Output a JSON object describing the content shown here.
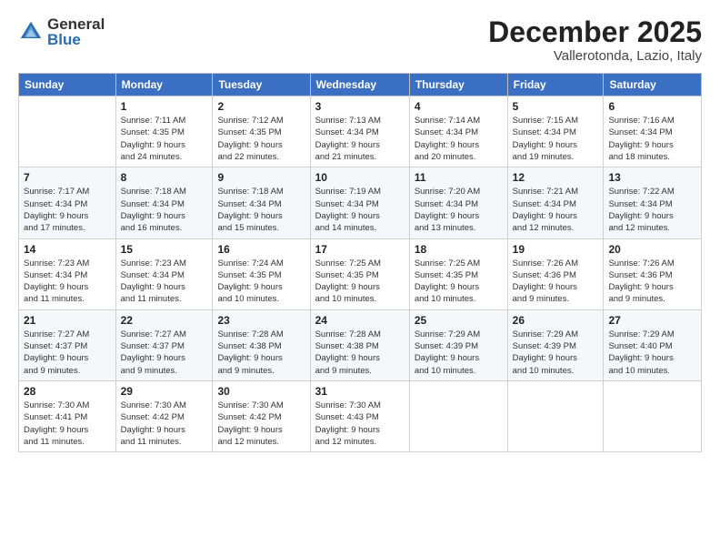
{
  "logo": {
    "general": "General",
    "blue": "Blue"
  },
  "header": {
    "month": "December 2025",
    "location": "Vallerotonda, Lazio, Italy"
  },
  "days_of_week": [
    "Sunday",
    "Monday",
    "Tuesday",
    "Wednesday",
    "Thursday",
    "Friday",
    "Saturday"
  ],
  "weeks": [
    [
      {
        "day": "",
        "content": ""
      },
      {
        "day": "1",
        "content": "Sunrise: 7:11 AM\nSunset: 4:35 PM\nDaylight: 9 hours\nand 24 minutes."
      },
      {
        "day": "2",
        "content": "Sunrise: 7:12 AM\nSunset: 4:35 PM\nDaylight: 9 hours\nand 22 minutes."
      },
      {
        "day": "3",
        "content": "Sunrise: 7:13 AM\nSunset: 4:34 PM\nDaylight: 9 hours\nand 21 minutes."
      },
      {
        "day": "4",
        "content": "Sunrise: 7:14 AM\nSunset: 4:34 PM\nDaylight: 9 hours\nand 20 minutes."
      },
      {
        "day": "5",
        "content": "Sunrise: 7:15 AM\nSunset: 4:34 PM\nDaylight: 9 hours\nand 19 minutes."
      },
      {
        "day": "6",
        "content": "Sunrise: 7:16 AM\nSunset: 4:34 PM\nDaylight: 9 hours\nand 18 minutes."
      }
    ],
    [
      {
        "day": "7",
        "content": "Sunrise: 7:17 AM\nSunset: 4:34 PM\nDaylight: 9 hours\nand 17 minutes."
      },
      {
        "day": "8",
        "content": "Sunrise: 7:18 AM\nSunset: 4:34 PM\nDaylight: 9 hours\nand 16 minutes."
      },
      {
        "day": "9",
        "content": "Sunrise: 7:18 AM\nSunset: 4:34 PM\nDaylight: 9 hours\nand 15 minutes."
      },
      {
        "day": "10",
        "content": "Sunrise: 7:19 AM\nSunset: 4:34 PM\nDaylight: 9 hours\nand 14 minutes."
      },
      {
        "day": "11",
        "content": "Sunrise: 7:20 AM\nSunset: 4:34 PM\nDaylight: 9 hours\nand 13 minutes."
      },
      {
        "day": "12",
        "content": "Sunrise: 7:21 AM\nSunset: 4:34 PM\nDaylight: 9 hours\nand 12 minutes."
      },
      {
        "day": "13",
        "content": "Sunrise: 7:22 AM\nSunset: 4:34 PM\nDaylight: 9 hours\nand 12 minutes."
      }
    ],
    [
      {
        "day": "14",
        "content": "Sunrise: 7:23 AM\nSunset: 4:34 PM\nDaylight: 9 hours\nand 11 minutes."
      },
      {
        "day": "15",
        "content": "Sunrise: 7:23 AM\nSunset: 4:34 PM\nDaylight: 9 hours\nand 11 minutes."
      },
      {
        "day": "16",
        "content": "Sunrise: 7:24 AM\nSunset: 4:35 PM\nDaylight: 9 hours\nand 10 minutes."
      },
      {
        "day": "17",
        "content": "Sunrise: 7:25 AM\nSunset: 4:35 PM\nDaylight: 9 hours\nand 10 minutes."
      },
      {
        "day": "18",
        "content": "Sunrise: 7:25 AM\nSunset: 4:35 PM\nDaylight: 9 hours\nand 10 minutes."
      },
      {
        "day": "19",
        "content": "Sunrise: 7:26 AM\nSunset: 4:36 PM\nDaylight: 9 hours\nand 9 minutes."
      },
      {
        "day": "20",
        "content": "Sunrise: 7:26 AM\nSunset: 4:36 PM\nDaylight: 9 hours\nand 9 minutes."
      }
    ],
    [
      {
        "day": "21",
        "content": "Sunrise: 7:27 AM\nSunset: 4:37 PM\nDaylight: 9 hours\nand 9 minutes."
      },
      {
        "day": "22",
        "content": "Sunrise: 7:27 AM\nSunset: 4:37 PM\nDaylight: 9 hours\nand 9 minutes."
      },
      {
        "day": "23",
        "content": "Sunrise: 7:28 AM\nSunset: 4:38 PM\nDaylight: 9 hours\nand 9 minutes."
      },
      {
        "day": "24",
        "content": "Sunrise: 7:28 AM\nSunset: 4:38 PM\nDaylight: 9 hours\nand 9 minutes."
      },
      {
        "day": "25",
        "content": "Sunrise: 7:29 AM\nSunset: 4:39 PM\nDaylight: 9 hours\nand 10 minutes."
      },
      {
        "day": "26",
        "content": "Sunrise: 7:29 AM\nSunset: 4:39 PM\nDaylight: 9 hours\nand 10 minutes."
      },
      {
        "day": "27",
        "content": "Sunrise: 7:29 AM\nSunset: 4:40 PM\nDaylight: 9 hours\nand 10 minutes."
      }
    ],
    [
      {
        "day": "28",
        "content": "Sunrise: 7:30 AM\nSunset: 4:41 PM\nDaylight: 9 hours\nand 11 minutes."
      },
      {
        "day": "29",
        "content": "Sunrise: 7:30 AM\nSunset: 4:42 PM\nDaylight: 9 hours\nand 11 minutes."
      },
      {
        "day": "30",
        "content": "Sunrise: 7:30 AM\nSunset: 4:42 PM\nDaylight: 9 hours\nand 12 minutes."
      },
      {
        "day": "31",
        "content": "Sunrise: 7:30 AM\nSunset: 4:43 PM\nDaylight: 9 hours\nand 12 minutes."
      },
      {
        "day": "",
        "content": ""
      },
      {
        "day": "",
        "content": ""
      },
      {
        "day": "",
        "content": ""
      }
    ]
  ]
}
